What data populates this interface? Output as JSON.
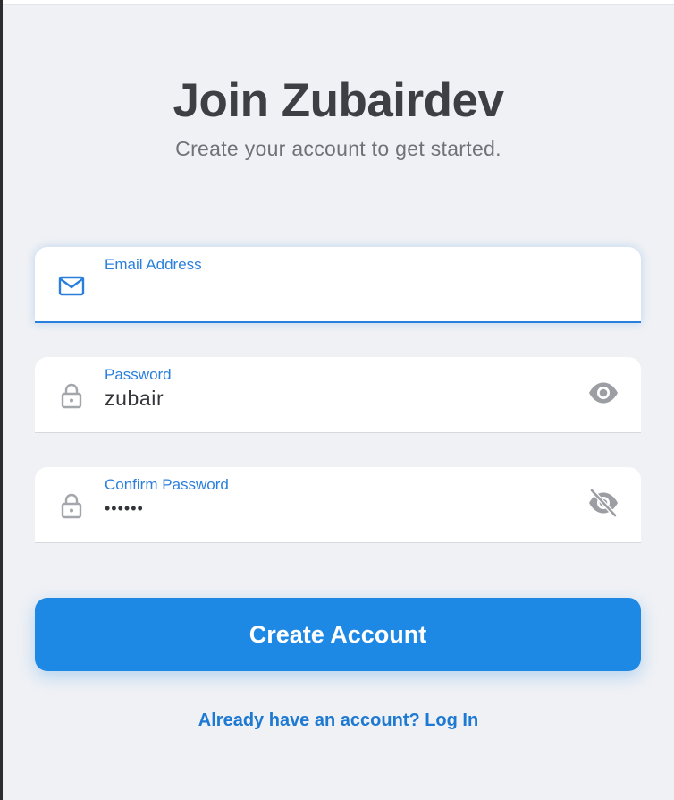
{
  "header": {
    "title": "Join Zubairdev",
    "subtitle": "Create your account to get started."
  },
  "form": {
    "email": {
      "label": "Email Address",
      "value": "",
      "icon": "mail-icon"
    },
    "password": {
      "label": "Password",
      "value": "zubair",
      "icon": "lock-icon",
      "toggle_icon": "eye-icon"
    },
    "confirm_password": {
      "label": "Confirm Password",
      "value": "••••••",
      "icon": "lock-icon",
      "toggle_icon": "eye-off-icon"
    },
    "submit_label": "Create Account"
  },
  "footer": {
    "login_link": "Already have an account? Log In"
  },
  "colors": {
    "background": "#eff1f5",
    "accent": "#1e88e5",
    "label": "#2a7fdc",
    "title": "#3d3f44",
    "subtitle": "#6f7378"
  }
}
